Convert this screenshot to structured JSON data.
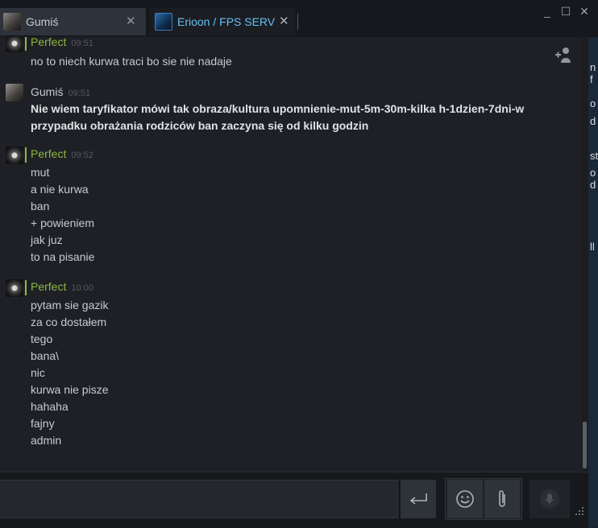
{
  "tabs": [
    {
      "title": "Gumiś",
      "close": "✕"
    },
    {
      "title": "Erioon / FPS SERV",
      "close": "✕"
    }
  ],
  "window_controls": {
    "minimize": "_",
    "maximize": "☐",
    "close": "✕"
  },
  "messages": [
    {
      "sender": "Perfect",
      "time": "09:51",
      "lines": [
        "no to niech kurwa traci bo sie nie nadaje"
      ]
    },
    {
      "sender": "Gumiś",
      "time": "09:51",
      "lines": [
        "Nie wiem taryfikator mówi tak obraza/kultura upomnienie-mut-5m-30m-kilka h-1dzien-7dni-w przypadku obrażania rodziców ban zaczyna się od kilku godzin"
      ]
    },
    {
      "sender": "Perfect",
      "time": "09:52",
      "lines": [
        "mut",
        "a nie kurwa",
        "ban",
        "+ powieniem",
        "jak juz",
        "to na pisanie"
      ]
    },
    {
      "sender": "Perfect",
      "time": "10:00",
      "lines": [
        "pytam sie gazik",
        "za co dostałem",
        "tego",
        "bana\\",
        "nic",
        "kurwa nie pisze",
        "hahaha",
        "fajny",
        "admin"
      ]
    }
  ],
  "input": {
    "value": "",
    "placeholder": ""
  },
  "icons": {
    "send": "enter-arrow-icon",
    "emoji": "smiley-icon",
    "attach": "paperclip-icon",
    "voice": "microphone-icon",
    "add_user": "add-user-icon"
  },
  "colors": {
    "online_name": "#8bb840",
    "tab_active_title": "#67c1f5",
    "background": "#1e2025"
  },
  "background_peek": [
    "n f",
    "o",
    "d",
    "st",
    "o d",
    "ll"
  ]
}
